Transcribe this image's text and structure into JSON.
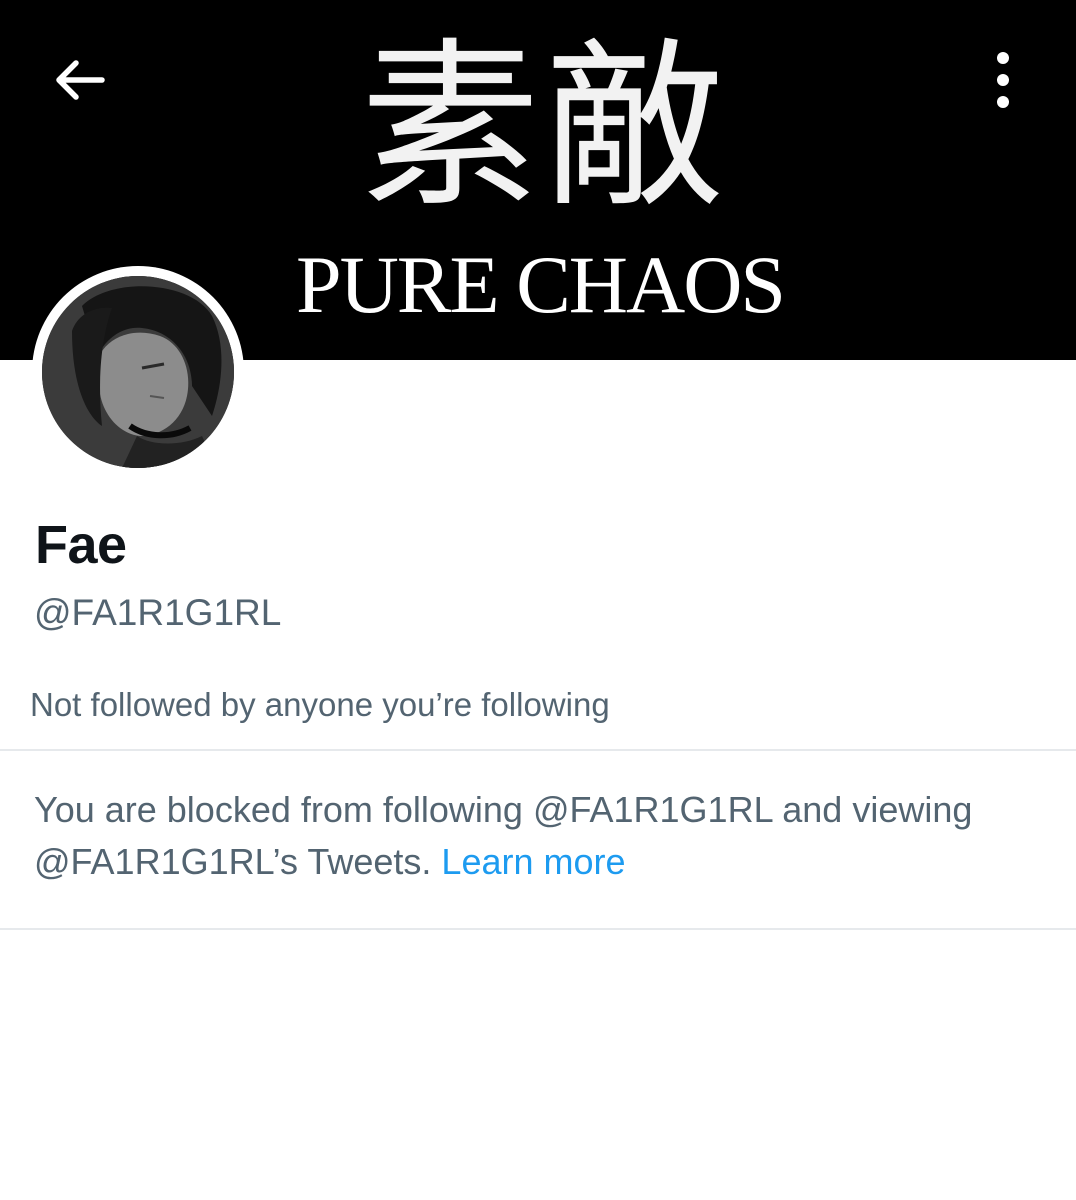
{
  "banner": {
    "kanji": "素敵",
    "subtitle": "PURE CHAOS"
  },
  "toolbar": {
    "back_icon": "arrow-left-icon",
    "more_icon": "vertical-ellipsis-icon"
  },
  "profile": {
    "display_name": "Fae",
    "handle": "@FA1R1G1RL",
    "followers_note": "Not followed by anyone you’re following"
  },
  "blocked": {
    "message": "You are blocked from following @FA1R1G1RL and viewing @FA1R1G1RL’s Tweets. ",
    "link": "Learn more"
  },
  "colors": {
    "banner_bg": "#000000",
    "primary_text": "#0f1419",
    "secondary_text": "#536471",
    "link": "#1d9bf0",
    "divider": "#e6e9ec"
  }
}
